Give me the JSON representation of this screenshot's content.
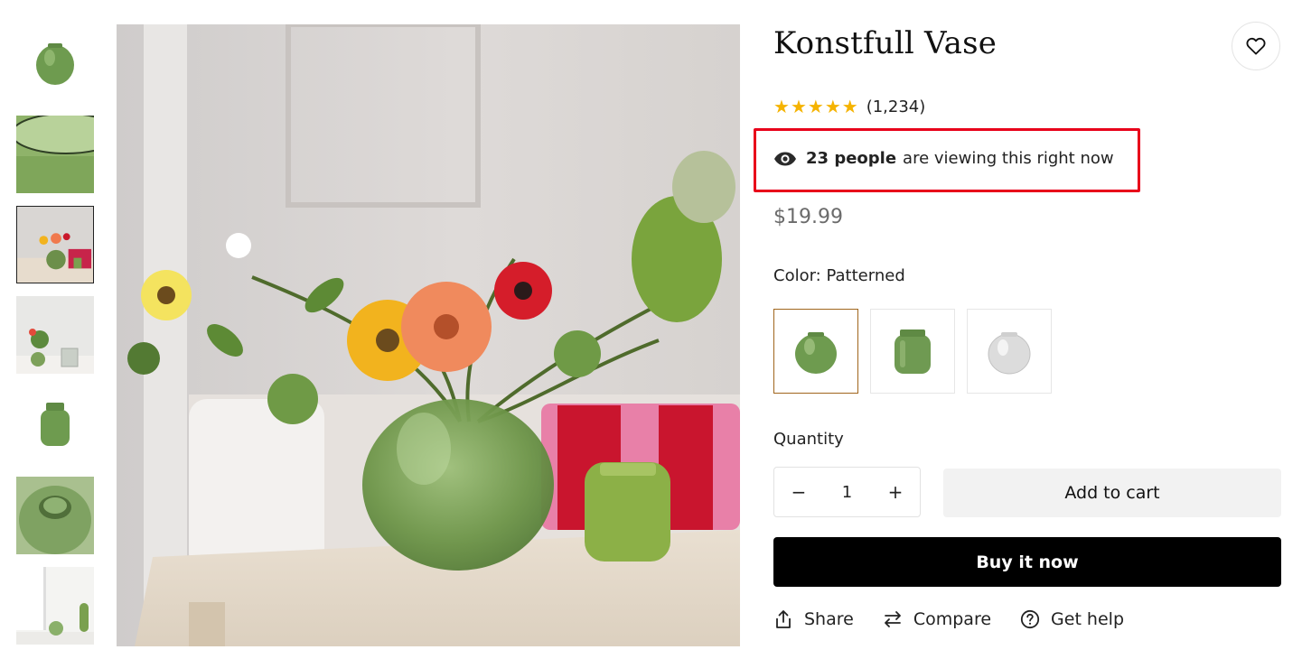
{
  "product": {
    "title": "Konstfull Vase",
    "rating_stars": 5,
    "review_count": "(1,234)",
    "viewing": {
      "count": "23 people",
      "suffix": "are viewing this right now"
    },
    "price": "$19.99",
    "color": {
      "label": "Color:",
      "value": "Patterned"
    },
    "quantity": {
      "label": "Quantity",
      "value": "1",
      "minus": "−",
      "plus": "+"
    },
    "add_to_cart": "Add to cart",
    "buy_now": "Buy it now"
  },
  "actions": {
    "share": "Share",
    "compare": "Compare",
    "get_help": "Get help"
  },
  "icons": {
    "wishlist": "heart-icon",
    "viewing": "eye-icon",
    "share": "share-icon",
    "compare": "compare-arrows-icon",
    "help": "question-circle-icon",
    "star": "star-icon"
  },
  "colors": {
    "star": "#f5b301",
    "highlight": "#e8001a",
    "buy_now_bg": "#000000",
    "add_to_cart_bg": "#f2f2f2",
    "selected_swatch": "#a0651c",
    "price": "#6b6b6b"
  },
  "gallery": {
    "thumbnail_count": 7,
    "active_index": 2
  }
}
